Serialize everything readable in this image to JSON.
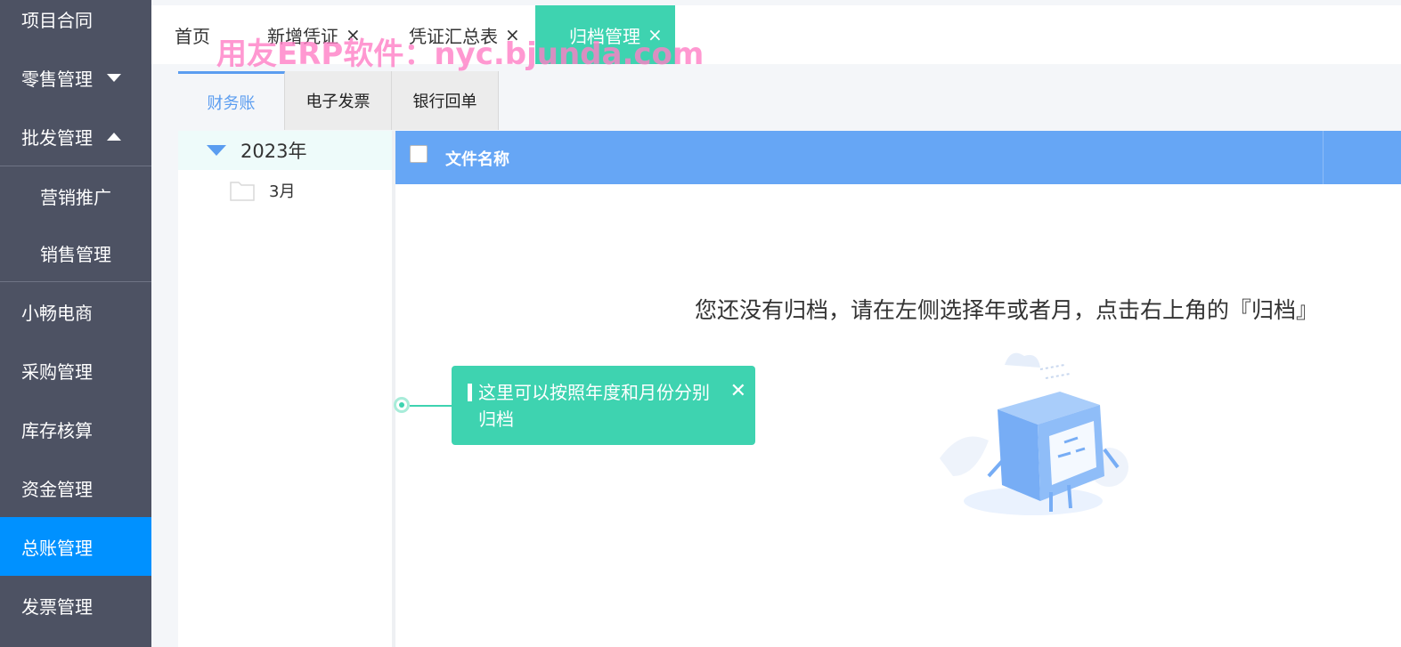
{
  "sidebar": {
    "items": [
      {
        "label": "项目合同"
      },
      {
        "label": "零售管理",
        "arrow": "chevron-down-icon"
      },
      {
        "label": "批发管理",
        "arrow": "chevron-up-icon"
      },
      {
        "label": "营销推广"
      },
      {
        "label": "销售管理"
      },
      {
        "label": "小畅电商"
      },
      {
        "label": "采购管理"
      },
      {
        "label": "库存核算"
      },
      {
        "label": "资金管理"
      },
      {
        "label": "总账管理",
        "active": true
      },
      {
        "label": "发票管理"
      }
    ]
  },
  "top_tabs": [
    {
      "label": "首页"
    },
    {
      "label": "新增凭证",
      "close": "×"
    },
    {
      "label": "凭证汇总表",
      "close": "×"
    },
    {
      "label": "归档管理",
      "close": "×",
      "active": true
    }
  ],
  "watermark": "用友ERP软件：nyc.bjunda.com",
  "sub_tabs": [
    {
      "label": "财务账",
      "active": true
    },
    {
      "label": "电子发票"
    },
    {
      "label": "银行回单"
    }
  ],
  "tree": {
    "year": "2023年",
    "month": "3月"
  },
  "table": {
    "header": "文件名称",
    "empty_message": "您还没有归档，请在左侧选择年或者月，点击右上角的『归档』"
  },
  "guide": {
    "text": "这里可以按照年度和月份分别归档",
    "close": "✕"
  },
  "colors": {
    "sidebar_bg": "#4d5263",
    "sidebar_active": "#0091ff",
    "accent_teal": "#3ed3b0",
    "table_header": "#66a6f5",
    "watermark": "#ff7fc6"
  }
}
